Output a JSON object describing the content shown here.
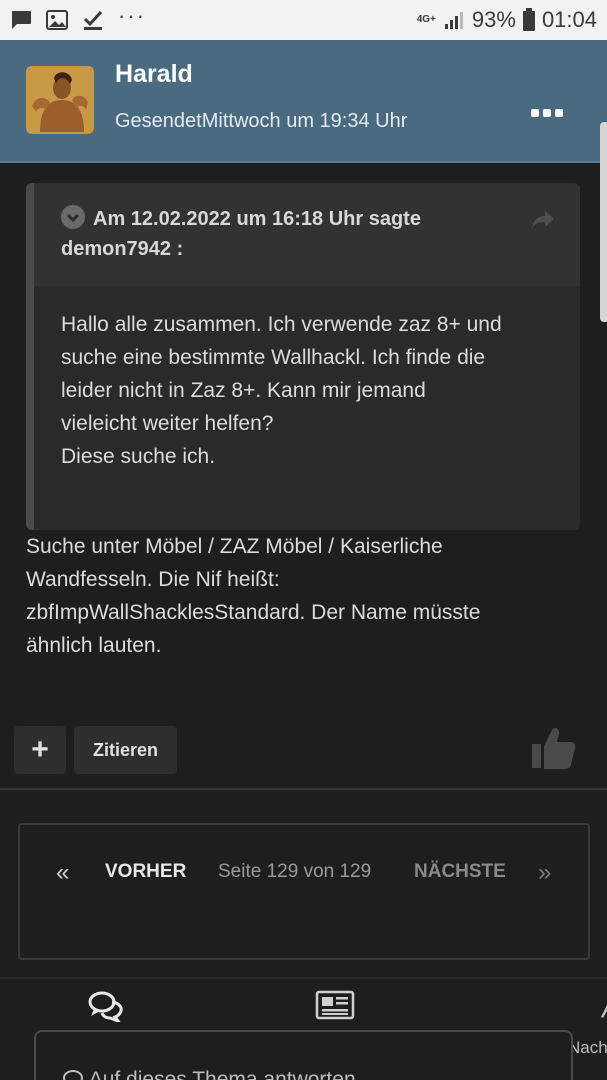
{
  "status_bar": {
    "network": "4G+",
    "battery": "93%",
    "time": "01:04",
    "left_icons": [
      "message-icon",
      "image-icon",
      "check-icon",
      "more-dots-icon"
    ]
  },
  "post": {
    "author": "Harald",
    "sent": "GesendetMittwoch um 19:34 Uhr",
    "quote": {
      "header": "Am 12.02.2022 um 16:18 Uhr sagte demon7942 :",
      "lines": [
        "Hallo alle zusammen. Ich verwende zaz 8+ und",
        "suche eine bestimmte Wallhackl. Ich finde die",
        "leider nicht in Zaz 8+. Kann mir jemand",
        "vieleicht weiter helfen?",
        "Diese suche ich."
      ]
    },
    "body_lines": [
      "Suche unter Möbel / ZAZ Möbel / Kaiserliche",
      "Wandfesseln. Die Nif heißt:",
      "zbfImpWallShacklesStandard. Der Name müsste",
      "ähnlich lauten."
    ],
    "actions": {
      "plus_label": "+",
      "quote_label": "Zitieren"
    }
  },
  "pagination": {
    "first_symbol": "«",
    "prev_label": "VORHER",
    "status": "Seite 129 von 129",
    "next_label": "NÄCHSTE",
    "last_symbol": "»"
  },
  "bottom_nav": {
    "message_partial": "Nachricht"
  },
  "reply": {
    "placeholder": "Auf dieses Thema antworten"
  },
  "colors": {
    "header_bg": "#4a6a80",
    "page_bg": "#1e1e1e",
    "quote_bg": "#2a2a2a"
  }
}
